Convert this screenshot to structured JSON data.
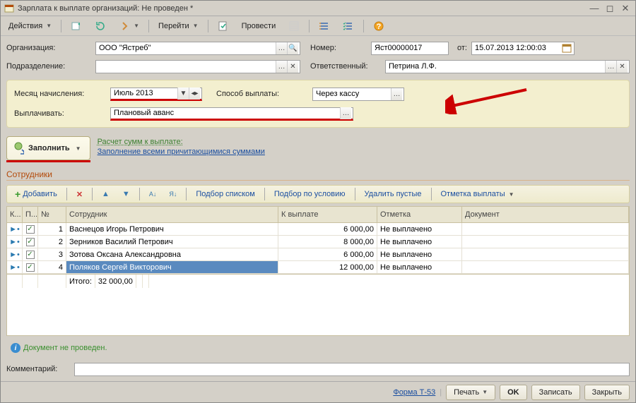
{
  "window": {
    "title": "Зарплата к выплате организаций: Не проведен *"
  },
  "toolbar": {
    "actions": "Действия",
    "goto": "Перейти",
    "post": "Провести"
  },
  "header": {
    "org_label": "Организация:",
    "org_value": "ООО \"Ястреб\"",
    "number_label": "Номер:",
    "number_value": "Яст00000017",
    "date_label": "от:",
    "date_value": "15.07.2013 12:00:03",
    "dept_label": "Подразделение:",
    "resp_label": "Ответственный:",
    "resp_value": "Петрина Л.Ф."
  },
  "yellow": {
    "month_label": "Месяц начисления:",
    "month_value": "Июль 2013",
    "paymethod_label": "Способ выплаты:",
    "paymethod_value": "Через кассу",
    "paytype_label": "Выплачивать:",
    "paytype_value": "Плановый аванс"
  },
  "fill": {
    "button": "Заполнить",
    "link_title": "Расчет сумм к выплате:",
    "link_sub": "Заполнение всеми причитающимися суммами"
  },
  "section": {
    "title": "Сотрудники"
  },
  "gridtb": {
    "add": "Добавить",
    "pick_list": "Подбор списком",
    "pick_cond": "Подбор по условию",
    "del_empty": "Удалить пустые",
    "mark_pay": "Отметка выплаты"
  },
  "cols": {
    "k": "К...",
    "p": "П...",
    "n": "№",
    "emp": "Сотрудник",
    "amt": "К выплате",
    "mark": "Отметка",
    "doc": "Документ"
  },
  "rows": [
    {
      "n": "1",
      "emp": "Васнецов Игорь Петрович",
      "amt": "6 000,00",
      "mark": "Не выплачено"
    },
    {
      "n": "2",
      "emp": "Зерников Василий Петрович",
      "amt": "8 000,00",
      "mark": "Не выплачено"
    },
    {
      "n": "3",
      "emp": "Зотова Оксана Александровна",
      "amt": "6 000,00",
      "mark": "Не выплачено"
    },
    {
      "n": "4",
      "emp": "Поляков Сергей Викторович",
      "amt": "12 000,00",
      "mark": "Не выплачено"
    }
  ],
  "totals": {
    "label": "Итого:",
    "amt": "32 000,00"
  },
  "status": {
    "text": "Документ не проведен."
  },
  "comment": {
    "label": "Комментарий:"
  },
  "footer": {
    "form": "Форма Т-53",
    "print": "Печать",
    "ok": "OK",
    "save": "Записать",
    "close": "Закрыть"
  }
}
